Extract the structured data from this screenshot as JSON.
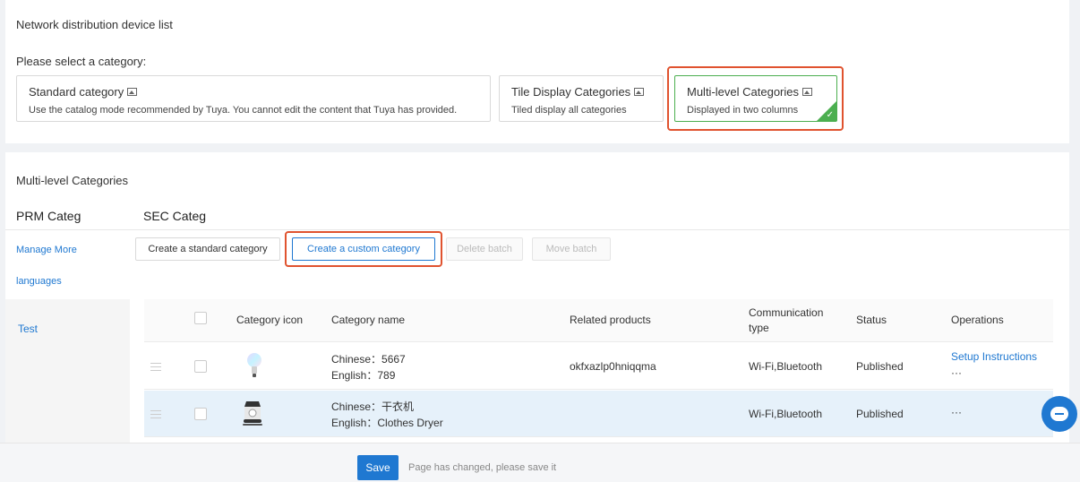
{
  "header": {
    "title": "Network distribution device list",
    "select_label": "Please select a category:"
  },
  "category_modes": [
    {
      "title": "Standard category",
      "desc": "Use the catalog mode recommended by Tuya. You cannot edit the content that Tuya has provided.",
      "selected": false
    },
    {
      "title": "Tile Display Categories",
      "desc": "Tiled display all categories",
      "selected": false
    },
    {
      "title": "Multi-level Categories",
      "desc": "Displayed in two columns",
      "selected": true
    }
  ],
  "section": {
    "title": "Multi-level Categories",
    "prm_header": "PRM Categ",
    "sec_header": "SEC Categ"
  },
  "left_panel": {
    "manage_line1": "Manage More",
    "manage_line2": "languages",
    "items": [
      "Test"
    ]
  },
  "toolbar": {
    "create_standard": "Create a standard category",
    "create_custom": "Create a custom category",
    "delete_batch": "Delete batch",
    "move_batch": "Move batch"
  },
  "table": {
    "columns": {
      "icon": "Category icon",
      "name": "Category name",
      "products": "Related products",
      "comm_line1": "Communication",
      "comm_line2": "type",
      "status": "Status",
      "ops": "Operations"
    },
    "rows": [
      {
        "icon": "light-bulb-icon",
        "name_cn": "Chinese：5667",
        "name_en": "English：789",
        "products": "okfxazlp0hniqqma",
        "comm": "Wi-Fi,Bluetooth",
        "status": "Published",
        "op_link": "Setup Instructions",
        "op_more": "···"
      },
      {
        "icon": "clothes-dryer-icon",
        "name_cn": "Chinese：干衣机",
        "name_en": "English：Clothes Dryer",
        "products": "",
        "comm": "Wi-Fi,Bluetooth",
        "status": "Published",
        "op_link": "",
        "op_more": "···"
      }
    ]
  },
  "footer": {
    "save": "Save",
    "note": "Page has changed, please save it"
  },
  "colors": {
    "accent": "#1f78d1",
    "selected": "#4caf50",
    "highlight_box": "#e0532f",
    "row_highlight": "#e6f1fa"
  }
}
